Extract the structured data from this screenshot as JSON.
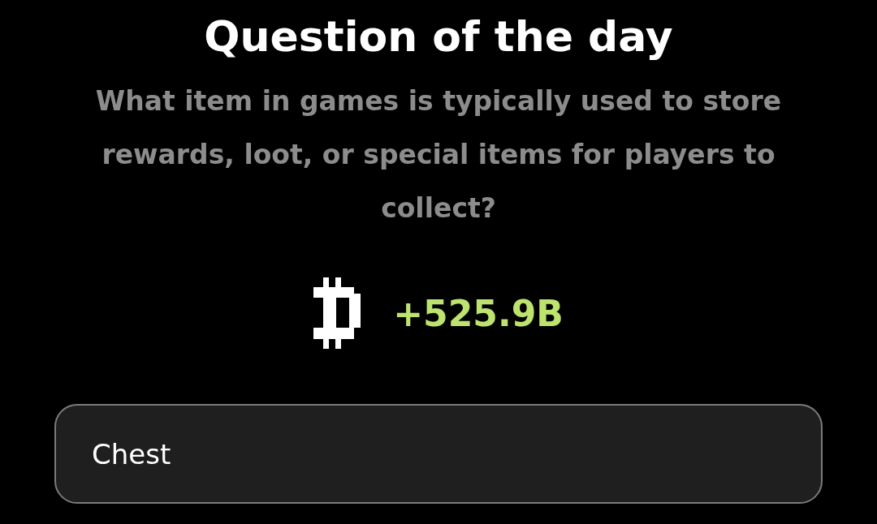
{
  "title": "Question of the day",
  "question": "What item in games is typically used to store rewards, loot, or special items for players to collect?",
  "reward": "+525.9B",
  "answer": {
    "value": "Chest"
  }
}
